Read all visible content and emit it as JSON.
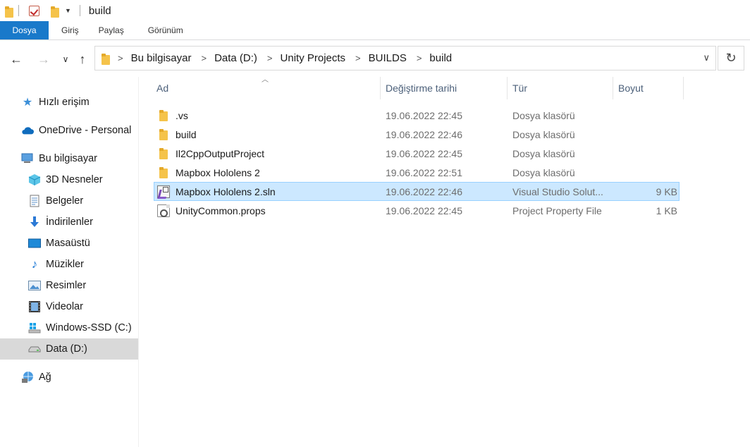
{
  "window": {
    "title": "build"
  },
  "ribbon": {
    "tabs": [
      {
        "label": "Dosya"
      },
      {
        "label": "Giriş"
      },
      {
        "label": "Paylaş"
      },
      {
        "label": "Görünüm"
      }
    ]
  },
  "nav": {
    "back_symbol": "←",
    "forward_symbol": "→",
    "recent_symbol": "∨",
    "up_symbol": "↑",
    "refresh_symbol": "↻",
    "dropdown_symbol": "∨"
  },
  "breadcrumb": [
    {
      "label": "Bu bilgisayar"
    },
    {
      "label": "Data (D:)"
    },
    {
      "label": "Unity Projects"
    },
    {
      "label": "BUILDS"
    },
    {
      "label": "build"
    }
  ],
  "sidebar": {
    "items": [
      {
        "label": "Hızlı erişim",
        "icon": "star-icon"
      },
      {
        "label": "OneDrive - Personal",
        "icon": "cloud-icon"
      },
      {
        "label": "Bu bilgisayar",
        "icon": "computer-icon"
      },
      {
        "label": "3D Nesneler",
        "icon": "3d-objects-icon"
      },
      {
        "label": "Belgeler",
        "icon": "documents-icon"
      },
      {
        "label": "İndirilenler",
        "icon": "download-icon"
      },
      {
        "label": "Masaüstü",
        "icon": "desktop-icon"
      },
      {
        "label": "Müzikler",
        "icon": "music-icon"
      },
      {
        "label": "Resimler",
        "icon": "pictures-icon"
      },
      {
        "label": "Videolar",
        "icon": "videos-icon"
      },
      {
        "label": "Windows-SSD (C:)",
        "icon": "windows-drive-icon"
      },
      {
        "label": "Data (D:)",
        "icon": "drive-icon",
        "selected": true
      },
      {
        "label": "Ağ",
        "icon": "network-icon"
      }
    ]
  },
  "columns": {
    "name": "Ad",
    "date": "Değiştirme tarihi",
    "type": "Tür",
    "size": "Boyut"
  },
  "files": [
    {
      "name": ".vs",
      "date": "19.06.2022 22:45",
      "type": "Dosya klasörü",
      "size": "",
      "icon": "folder-icon"
    },
    {
      "name": "build",
      "date": "19.06.2022 22:46",
      "type": "Dosya klasörü",
      "size": "",
      "icon": "folder-icon"
    },
    {
      "name": "Il2CppOutputProject",
      "date": "19.06.2022 22:45",
      "type": "Dosya klasörü",
      "size": "",
      "icon": "folder-icon"
    },
    {
      "name": "Mapbox Hololens 2",
      "date": "19.06.2022 22:51",
      "type": "Dosya klasörü",
      "size": "",
      "icon": "folder-icon"
    },
    {
      "name": "Mapbox Hololens 2.sln",
      "date": "19.06.2022 22:46",
      "type": "Visual Studio Solut...",
      "size": "9 KB",
      "icon": "solution-file-icon",
      "selected": true
    },
    {
      "name": "UnityCommon.props",
      "date": "19.06.2022 22:45",
      "type": "Project Property File",
      "size": "1 KB",
      "icon": "props-file-icon"
    }
  ],
  "colors": {
    "accent": "#1979ca",
    "selection": "#cce8ff",
    "selection_border": "#99d1ff",
    "sidebar_selected": "#d9d9d9",
    "folder": "#f5c34a"
  }
}
